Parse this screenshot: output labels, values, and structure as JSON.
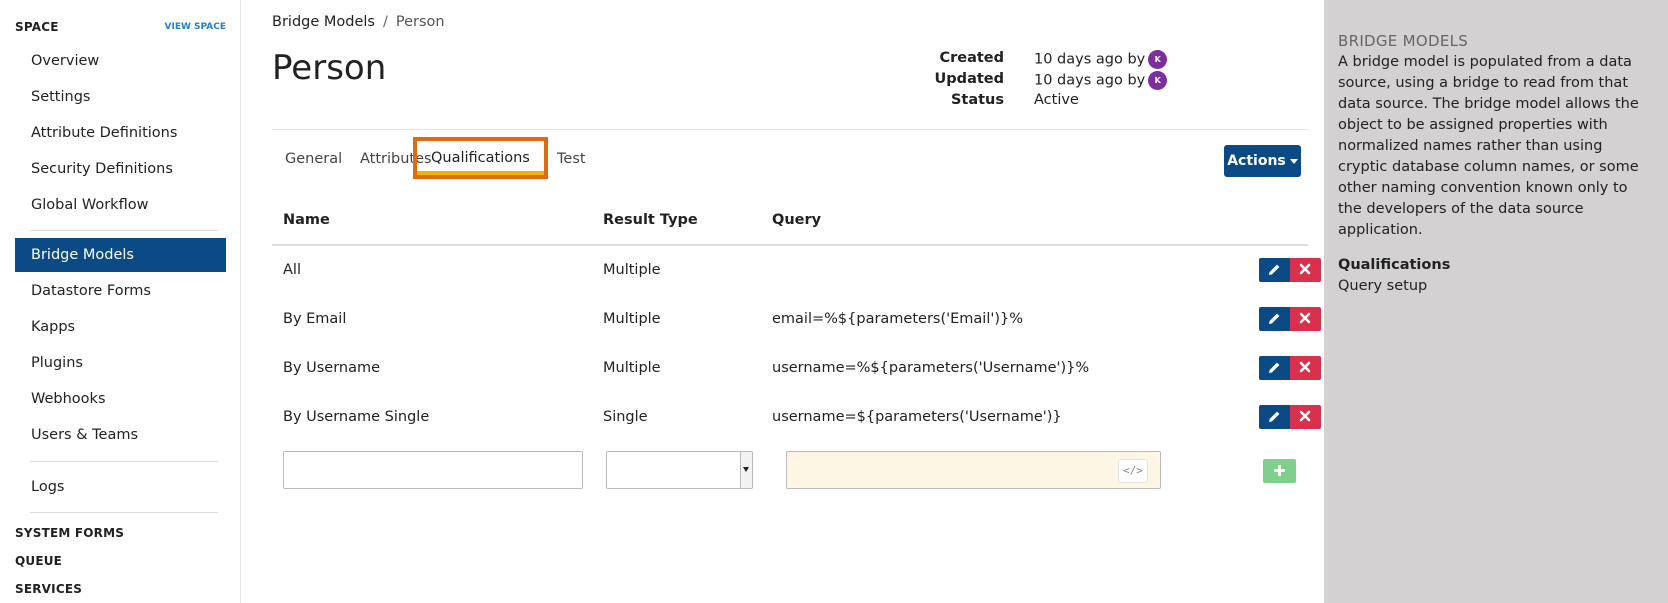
{
  "sidebar": {
    "space_label": "SPACE",
    "view_space": "VIEW SPACE",
    "items_top": [
      "Overview",
      "Settings",
      "Attribute Definitions",
      "Security Definitions",
      "Global Workflow"
    ],
    "items_mid": [
      "Bridge Models",
      "Datastore Forms",
      "Kapps",
      "Plugins",
      "Webhooks",
      "Users & Teams"
    ],
    "items_bottom": [
      "Logs"
    ],
    "sections": [
      "SYSTEM FORMS",
      "QUEUE",
      "SERVICES"
    ]
  },
  "breadcrumb": {
    "parent": "Bridge Models",
    "separator": "/",
    "current": "Person"
  },
  "page": {
    "title": "Person"
  },
  "meta": {
    "created_label": "Created",
    "created_value": "10 days ago by",
    "updated_label": "Updated",
    "updated_value": "10 days ago by",
    "status_label": "Status",
    "status_value": "Active",
    "avatar_initial": "K"
  },
  "tabs": [
    "General",
    "Attributes",
    "Qualifications",
    "Test"
  ],
  "active_tab": "Qualifications",
  "actions_label": "Actions",
  "table": {
    "headers": [
      "Name",
      "Result Type",
      "Query"
    ],
    "rows": [
      {
        "name": "All",
        "type": "Multiple",
        "query": ""
      },
      {
        "name": "By Email",
        "type": "Multiple",
        "query": "email=%${parameters('Email')}%"
      },
      {
        "name": "By Username",
        "type": "Multiple",
        "query": "username=%${parameters('Username')}%"
      },
      {
        "name": "By Username Single",
        "type": "Single",
        "query": "username=${parameters('Username')}"
      }
    ],
    "code_button": "</>"
  },
  "right_panel": {
    "title": "BRIDGE MODELS",
    "description": "A bridge model is populated from a data source, using a bridge to read from that data source. The bridge model allows the object to be assigned properties with normalized names rather than using cryptic database column names, or some other naming convention known only to the developers of the data source application.",
    "subtitle": "Qualifications",
    "subtext": "Query setup"
  },
  "colors": {
    "primary": "#0b4a85",
    "danger": "#d9304b",
    "success": "#7fcf8d",
    "highlight": "#e06a12",
    "avatar": "#7a2f9c",
    "panel": "#d3d1d1"
  }
}
